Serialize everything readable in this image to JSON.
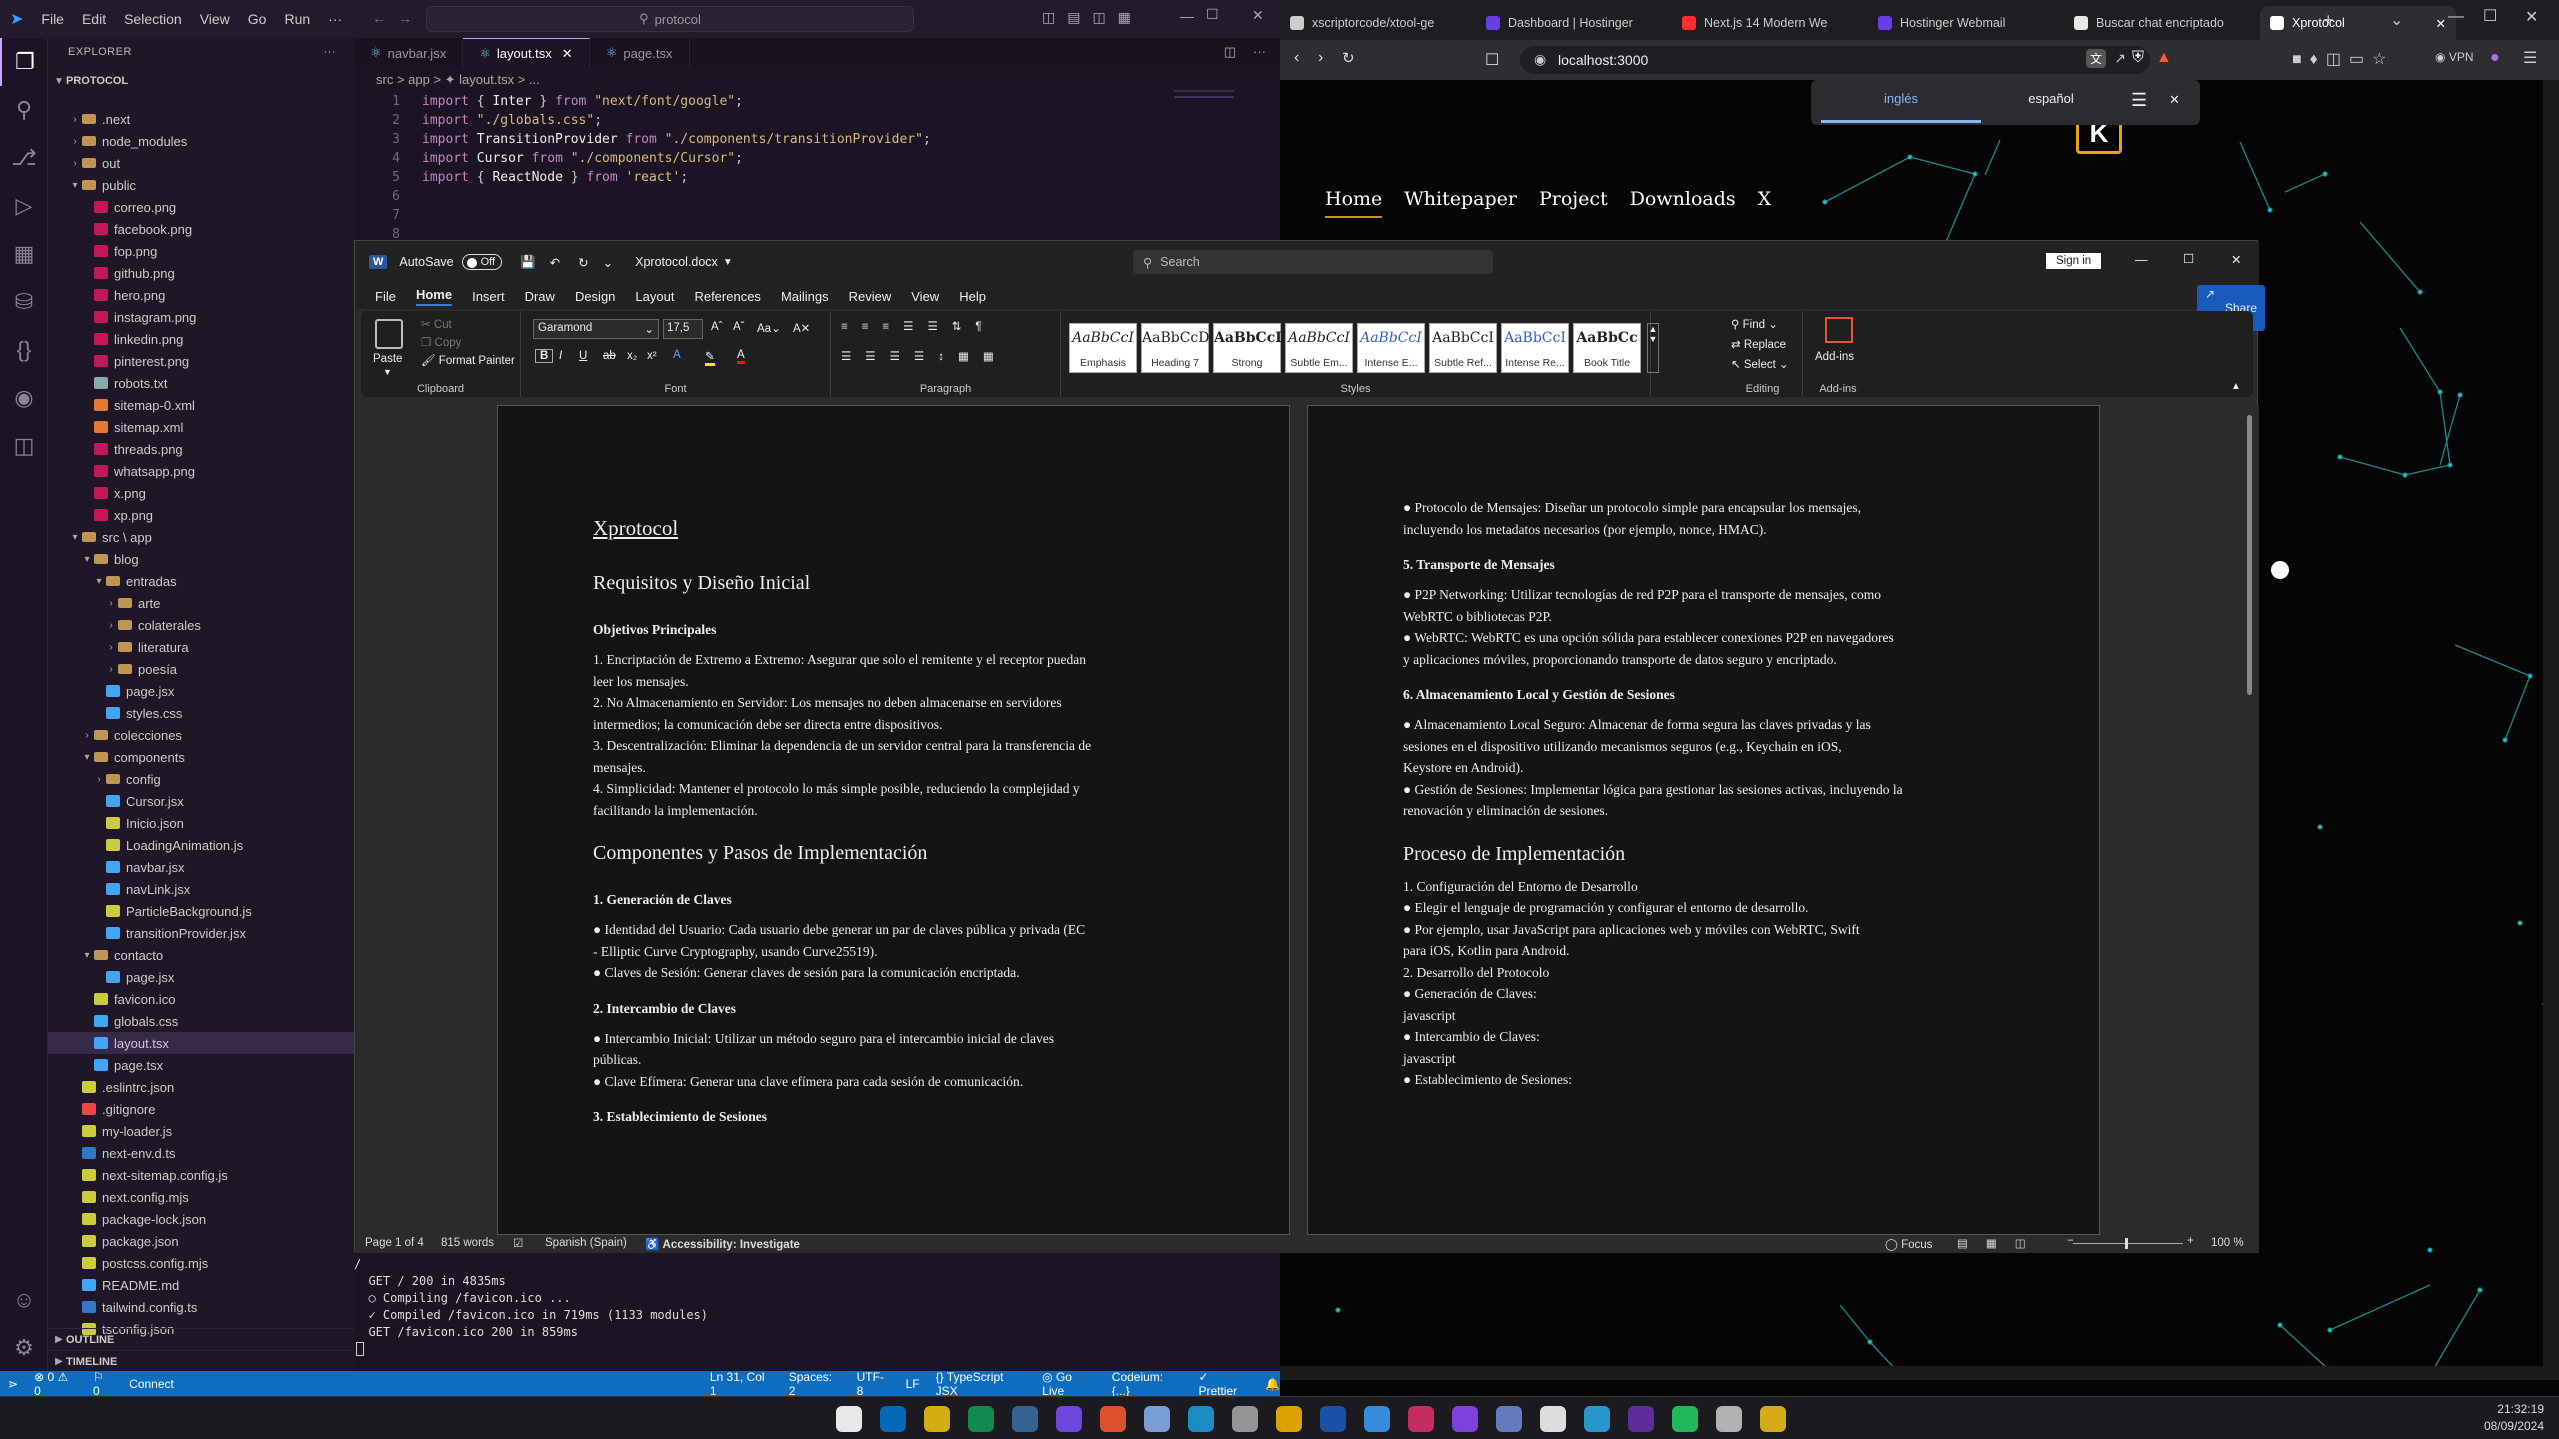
{
  "vscode": {
    "menu": [
      "File",
      "Edit",
      "Selection",
      "View",
      "Go",
      "Run",
      "···"
    ],
    "search_text": "protocol",
    "explorer_label": "EXPLORER",
    "project": "PROTOCOL",
    "tree": [
      {
        "label": ".next",
        "depth": 1,
        "type": "folder",
        "open": false
      },
      {
        "label": "node_modules",
        "depth": 1,
        "type": "folder",
        "open": false
      },
      {
        "label": "out",
        "depth": 1,
        "type": "folder",
        "open": false
      },
      {
        "label": "public",
        "depth": 1,
        "type": "folder",
        "open": true
      },
      {
        "label": "correo.png",
        "depth": 2,
        "type": "img"
      },
      {
        "label": "facebook.png",
        "depth": 2,
        "type": "img"
      },
      {
        "label": "fop.png",
        "depth": 2,
        "type": "img"
      },
      {
        "label": "github.png",
        "depth": 2,
        "type": "img"
      },
      {
        "label": "hero.png",
        "depth": 2,
        "type": "img"
      },
      {
        "label": "instagram.png",
        "depth": 2,
        "type": "img"
      },
      {
        "label": "linkedin.png",
        "depth": 2,
        "type": "img"
      },
      {
        "label": "pinterest.png",
        "depth": 2,
        "type": "img"
      },
      {
        "label": "robots.txt",
        "depth": 2,
        "type": "txt"
      },
      {
        "label": "sitemap-0.xml",
        "depth": 2,
        "type": "xml"
      },
      {
        "label": "sitemap.xml",
        "depth": 2,
        "type": "xml"
      },
      {
        "label": "threads.png",
        "depth": 2,
        "type": "img"
      },
      {
        "label": "whatsapp.png",
        "depth": 2,
        "type": "img"
      },
      {
        "label": "x.png",
        "depth": 2,
        "type": "img"
      },
      {
        "label": "xp.png",
        "depth": 2,
        "type": "img"
      },
      {
        "label": "src \\ app",
        "depth": 1,
        "type": "folder",
        "open": true
      },
      {
        "label": "blog",
        "depth": 2,
        "type": "folder",
        "open": true
      },
      {
        "label": "entradas",
        "depth": 3,
        "type": "folder",
        "open": true
      },
      {
        "label": "arte",
        "depth": 4,
        "type": "folder",
        "open": false
      },
      {
        "label": "colaterales",
        "depth": 4,
        "type": "folder",
        "open": false
      },
      {
        "label": "literatura",
        "depth": 4,
        "type": "folder",
        "open": false
      },
      {
        "label": "poesía",
        "depth": 4,
        "type": "folder",
        "open": false
      },
      {
        "label": "page.jsx",
        "depth": 3,
        "type": "jsx"
      },
      {
        "label": "styles.css",
        "depth": 3,
        "type": "css"
      },
      {
        "label": "colecciones",
        "depth": 2,
        "type": "folder",
        "open": false
      },
      {
        "label": "components",
        "depth": 2,
        "type": "folder",
        "open": true
      },
      {
        "label": "config",
        "depth": 3,
        "type": "folder",
        "open": false
      },
      {
        "label": "Cursor.jsx",
        "depth": 3,
        "type": "jsx"
      },
      {
        "label": "Inicio.json",
        "depth": 3,
        "type": "json"
      },
      {
        "label": "LoadingAnimation.js",
        "depth": 3,
        "type": "js"
      },
      {
        "label": "navbar.jsx",
        "depth": 3,
        "type": "jsx"
      },
      {
        "label": "navLink.jsx",
        "depth": 3,
        "type": "jsx"
      },
      {
        "label": "ParticleBackground.js",
        "depth": 3,
        "type": "js"
      },
      {
        "label": "transitionProvider.jsx",
        "depth": 3,
        "type": "jsx"
      },
      {
        "label": "contacto",
        "depth": 2,
        "type": "folder",
        "open": true
      },
      {
        "label": "page.jsx",
        "depth": 3,
        "type": "jsx"
      },
      {
        "label": "favicon.ico",
        "depth": 2,
        "type": "ico"
      },
      {
        "label": "globals.css",
        "depth": 2,
        "type": "css"
      },
      {
        "label": "layout.tsx",
        "depth": 2,
        "type": "tsx",
        "selected": true
      },
      {
        "label": "page.tsx",
        "depth": 2,
        "type": "tsx"
      },
      {
        "label": ".eslintrc.json",
        "depth": 1,
        "type": "json"
      },
      {
        "label": ".gitignore",
        "depth": 1,
        "type": "git"
      },
      {
        "label": "my-loader.js",
        "depth": 1,
        "type": "js"
      },
      {
        "label": "next-env.d.ts",
        "depth": 1,
        "type": "ts"
      },
      {
        "label": "next-sitemap.config.js",
        "depth": 1,
        "type": "js"
      },
      {
        "label": "next.config.mjs",
        "depth": 1,
        "type": "js"
      },
      {
        "label": "package-lock.json",
        "depth": 1,
        "type": "json"
      },
      {
        "label": "package.json",
        "depth": 1,
        "type": "json"
      },
      {
        "label": "postcss.config.mjs",
        "depth": 1,
        "type": "js"
      },
      {
        "label": "README.md",
        "depth": 1,
        "type": "md"
      },
      {
        "label": "tailwind.config.ts",
        "depth": 1,
        "type": "ts"
      },
      {
        "label": "tsconfig.json",
        "depth": 1,
        "type": "json"
      }
    ],
    "outline_label": "OUTLINE",
    "timeline_label": "TIMELINE",
    "tabs": [
      "navbar.jsx",
      "layout.tsx",
      "page.tsx"
    ],
    "active_tab": 1,
    "breadcrumb": "src > app > ✦ layout.tsx > ...",
    "code": [
      [
        [
          "kw",
          "import"
        ],
        [
          "pl",
          " { "
        ],
        [
          "id",
          "Inter"
        ],
        [
          "pl",
          " } "
        ],
        [
          "kw",
          "from"
        ],
        [
          "str",
          " \"next/font/google\""
        ],
        [
          "pl",
          ";"
        ]
      ],
      [
        [
          "kw",
          "import"
        ],
        [
          "str",
          " \"./globals.css\""
        ],
        [
          "pl",
          ";"
        ]
      ],
      [
        [
          "kw",
          "import"
        ],
        [
          "id",
          " TransitionProvider "
        ],
        [
          "kw",
          "from"
        ],
        [
          "str",
          " \"./components/transitionProvider\""
        ],
        [
          "pl",
          ";"
        ]
      ],
      [
        [
          "kw",
          "import"
        ],
        [
          "id",
          " Cursor "
        ],
        [
          "kw",
          "from"
        ],
        [
          "str",
          " \"./components/Cursor\""
        ],
        [
          "pl",
          ";"
        ]
      ],
      [
        [
          "kw",
          "import"
        ],
        [
          "pl",
          " { "
        ],
        [
          "id",
          "ReactNode"
        ],
        [
          "pl",
          " } "
        ],
        [
          "kw",
          "from"
        ],
        [
          "str",
          " 'react'"
        ],
        [
          "pl",
          ";"
        ]
      ],
      [],
      [],
      []
    ],
    "terminal": [
      "/",
      "/",
      "  GET / 200 in 4835ms",
      "  ○ Compiling /favicon.ico ...",
      "  ✓ Compiled /favicon.ico in 719ms (1133 modules)",
      "  GET /favicon.ico 200 in 859ms"
    ],
    "status": [
      "⊗ 0 ⚠ 0",
      "⚐ 0",
      "Connect",
      "Ln 31, Col 1",
      "Spaces: 2",
      "UTF-8",
      "LF",
      "{} TypeScript JSX",
      "◎ Go Live",
      "Codeium: {...}",
      "✓ Prettier"
    ]
  },
  "browser": {
    "tabs": [
      {
        "label": "xscriptorcode/xtool-ge",
        "color": "#cccccc"
      },
      {
        "label": "Dashboard | Hostinger",
        "color": "#673de6"
      },
      {
        "label": "Next.js 14 Modern We",
        "color": "#ff2d2d"
      },
      {
        "label": "Hostinger Webmail",
        "color": "#673de6"
      },
      {
        "label": "Buscar chat encriptado",
        "color": "#e8e8e8"
      },
      {
        "label": "Xprotocol",
        "color": "#ffffff"
      }
    ],
    "active_tab": 5,
    "url": "localhost:3000",
    "vpn": "VPN",
    "site_nav": [
      "Home",
      "Whitepaper",
      "Project",
      "Downloads",
      "X"
    ],
    "logo": "K",
    "translate": {
      "lang1": "inglés",
      "lang2": "español"
    }
  },
  "word": {
    "autosave": "AutoSave",
    "autosave_state": "Off",
    "filename": "Xprotocol.docx",
    "search": "Search",
    "signin": "Sign in",
    "menu": [
      "File",
      "Home",
      "Insert",
      "Draw",
      "Design",
      "Layout",
      "References",
      "Mailings",
      "Review",
      "View",
      "Help"
    ],
    "share": "Share",
    "clipboard": {
      "paste": "Paste",
      "cut": "Cut",
      "copy": "Copy",
      "format_painter": "Format Painter",
      "label": "Clipboard"
    },
    "font": {
      "name": "Garamond",
      "size": "17,5",
      "label": "Font"
    },
    "paragraph_label": "Paragraph",
    "styles": [
      {
        "preview": "AaBbCcI",
        "name": "Emphasis"
      },
      {
        "preview": "AaBbCcDc",
        "name": "Heading 7"
      },
      {
        "preview": "AaBbCcI",
        "name": "Strong"
      },
      {
        "preview": "AaBbCcI",
        "name": "Subtle Em..."
      },
      {
        "preview": "AaBbCcI",
        "name": "Intense E..."
      },
      {
        "preview": "AaBbCcI",
        "name": "Subtle Ref..."
      },
      {
        "preview": "AaBbCcI",
        "name": "Intense Re..."
      },
      {
        "preview": "AaBbCc",
        "name": "Book Title"
      }
    ],
    "styles_label": "Styles",
    "editing": {
      "find": "Find",
      "replace": "Replace",
      "select": "Select",
      "label": "Editing"
    },
    "addins": {
      "button": "Add-ins",
      "label": "Add-ins"
    },
    "page1": [
      {
        "cls": "h1",
        "text": "Xprotocol",
        "u": true
      },
      {
        "cls": "h2",
        "text": "Requisitos y Diseño Inicial"
      },
      {
        "cls": "hb",
        "text": "Objetivos Principales"
      },
      {
        "cls": "bd",
        "text": "1.    Encriptación de Extremo a Extremo: Asegurar que solo el remitente y el receptor puedan"
      },
      {
        "cls": "bd",
        "text": "       leer los mensajes."
      },
      {
        "cls": "bd",
        "text": "2.    No Almacenamiento en Servidor: Los mensajes no deben almacenarse en servidores"
      },
      {
        "cls": "bd",
        "text": "       intermedios; la comunicación debe ser directa entre dispositivos."
      },
      {
        "cls": "bd",
        "text": "3.    Descentralización: Eliminar la dependencia de un servidor central para la transferencia de"
      },
      {
        "cls": "bd",
        "text": "       mensajes."
      },
      {
        "cls": "bd",
        "text": "4.    Simplicidad: Mantener el protocolo lo más simple posible, reduciendo la complejidad y"
      },
      {
        "cls": "bd",
        "text": "       facilitando la implementación."
      },
      {
        "cls": "h2",
        "text": "Componentes y Pasos de Implementación"
      },
      {
        "cls": "hb",
        "text": "1. Generación de Claves"
      },
      {
        "cls": "bd",
        "text": "●    Identidad del Usuario: Cada usuario debe generar un par de claves pública y privada (EC"
      },
      {
        "cls": "bd",
        "text": "       - Elliptic Curve Cryptography, usando Curve25519)."
      },
      {
        "cls": "bd",
        "text": "●    Claves de Sesión: Generar claves de sesión para la comunicación encriptada."
      },
      {
        "cls": "hb",
        "text": "2. Intercambio de Claves"
      },
      {
        "cls": "bd",
        "text": "●    Intercambio Inicial: Utilizar un método seguro para el intercambio inicial de claves"
      },
      {
        "cls": "bd",
        "text": "       públicas."
      },
      {
        "cls": "bd",
        "text": "●    Clave Efímera: Generar una clave efímera para cada sesión de comunicación."
      },
      {
        "cls": "hb",
        "text": "3. Establecimiento de Sesiones"
      }
    ],
    "page2": [
      {
        "cls": "bd",
        "text": "●    Protocolo de Mensajes: Diseñar un protocolo simple para encapsular los mensajes,"
      },
      {
        "cls": "bd",
        "text": "       incluyendo los metadatos necesarios (por ejemplo, nonce, HMAC)."
      },
      {
        "cls": "hb",
        "text": "5. Transporte de Mensajes"
      },
      {
        "cls": "bd",
        "text": "●    P2P Networking: Utilizar tecnologías de red P2P para el transporte de mensajes, como"
      },
      {
        "cls": "bd",
        "text": "       WebRTC o bibliotecas P2P."
      },
      {
        "cls": "bd",
        "text": "●    WebRTC: WebRTC es una opción sólida para establecer conexiones P2P en navegadores"
      },
      {
        "cls": "bd",
        "text": "       y aplicaciones móviles, proporcionando transporte de datos seguro y encriptado."
      },
      {
        "cls": "hb",
        "text": "6. Almacenamiento Local y Gestión de Sesiones"
      },
      {
        "cls": "bd",
        "text": "●    Almacenamiento Local Seguro: Almacenar de forma segura las claves privadas y las"
      },
      {
        "cls": "bd",
        "text": "       sesiones en el dispositivo utilizando mecanismos seguros (e.g., Keychain en iOS,"
      },
      {
        "cls": "bd",
        "text": "       Keystore en Android)."
      },
      {
        "cls": "bd",
        "text": "●    Gestión de Sesiones: Implementar lógica para gestionar las sesiones activas, incluyendo la"
      },
      {
        "cls": "bd",
        "text": "       renovación y eliminación de sesiones."
      },
      {
        "cls": "h2",
        "text": "Proceso de Implementación"
      },
      {
        "cls": "bd",
        "text": "1.    Configuración del Entorno de Desarrollo"
      },
      {
        "cls": "bd",
        "text": "              ●    Elegir el lenguaje de programación y configurar el entorno de desarrollo."
      },
      {
        "cls": "bd",
        "text": "              ●    Por ejemplo, usar JavaScript para aplicaciones web y móviles con WebRTC, Swift"
      },
      {
        "cls": "bd",
        "text": "                     para iOS, Kotlin para Android."
      },
      {
        "cls": "bd",
        "text": "2.    Desarrollo del Protocolo"
      },
      {
        "cls": "bd",
        "text": "              ●    Generación de Claves:"
      },
      {
        "cls": "bd",
        "text": "                     javascript"
      },
      {
        "cls": "bd",
        "text": "              ●    Intercambio de Claves:"
      },
      {
        "cls": "bd",
        "text": "                     javascript"
      },
      {
        "cls": "bd",
        "text": "              ●    Establecimiento de Sesiones:"
      }
    ],
    "status": {
      "page": "Page 1 of 4",
      "words": "815 words",
      "lang": "Spanish (Spain)",
      "access": "Accessibility: Investigate",
      "focus": "Focus",
      "zoom": "100 %"
    }
  },
  "taskbar": {
    "time": "21:32:19",
    "date": "08/09/2024"
  }
}
